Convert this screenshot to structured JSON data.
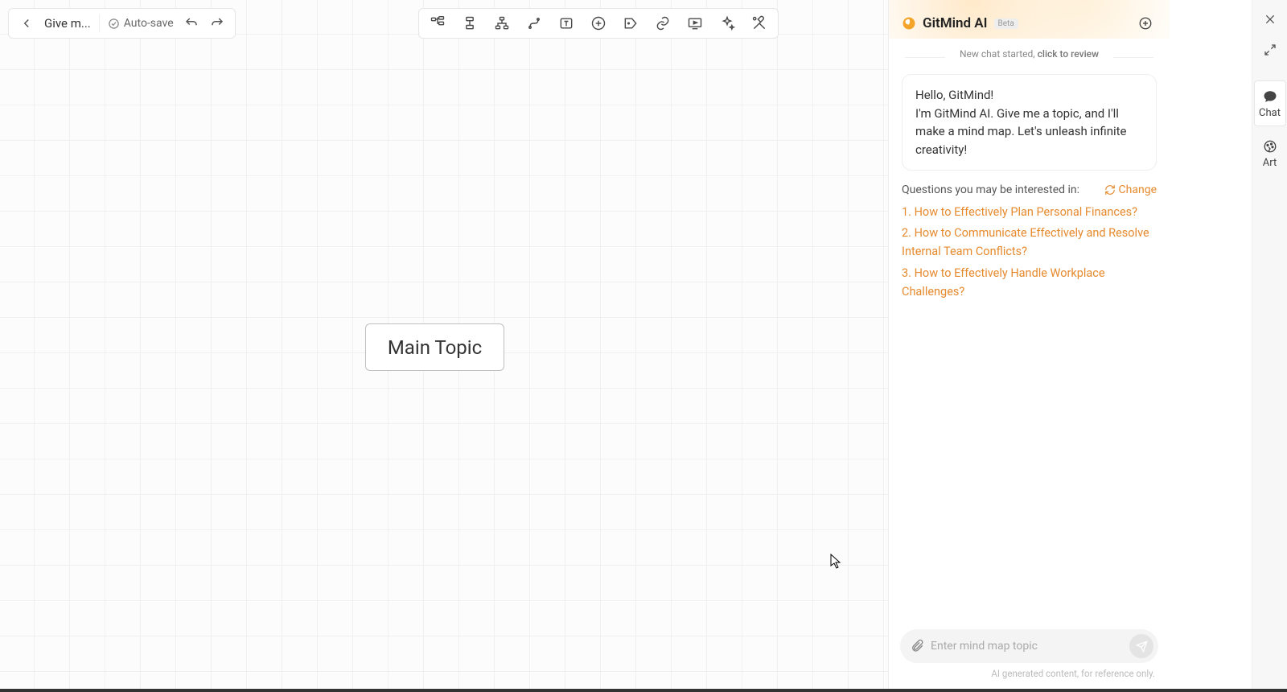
{
  "header": {
    "doc_title": "Give m...",
    "autosave_label": "Auto-save"
  },
  "canvas": {
    "main_topic_label": "Main Topic"
  },
  "ai_panel": {
    "brand_name": "GitMind AI",
    "beta_label": "Beta",
    "review_prefix": "New chat started, ",
    "review_link": "click to review",
    "greeting": "Hello, GitMind!\nI'm GitMind AI. Give me a topic, and I'll make a mind map. Let's unleash infinite creativity!",
    "suggestions_heading": "Questions you may be interested in:",
    "change_label": "Change",
    "suggestions": [
      "How to Effectively Plan Personal Finances?",
      "How to Communicate Effectively and Resolve Internal Team Conflicts?",
      "How to Effectively Handle Workplace Challenges?"
    ],
    "input_placeholder": "Enter mind map topic",
    "disclaimer": "AI generated content, for reference only."
  },
  "right_strip": {
    "chat_label": "Chat",
    "art_label": "Art"
  }
}
